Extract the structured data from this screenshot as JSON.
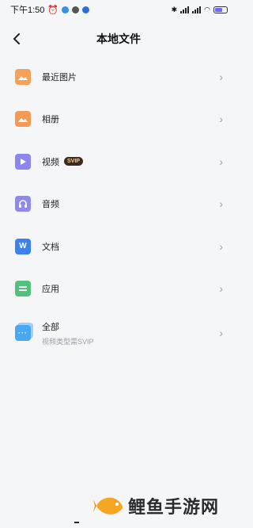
{
  "status_bar": {
    "time": "下午1:50",
    "battery_color": "#6b6bff"
  },
  "header": {
    "title": "本地文件",
    "back_icon": "chevron-left-icon"
  },
  "items": [
    {
      "label": "最近图片",
      "icon": "image-icon",
      "color": "#f5a15a"
    },
    {
      "label": "相册",
      "icon": "album-icon",
      "color": "#f59a55"
    },
    {
      "label": "视频",
      "icon": "video-play-icon",
      "color": "#8e86f0",
      "badge": "SVIP"
    },
    {
      "label": "音频",
      "icon": "headphones-icon",
      "color": "#8f89ef"
    },
    {
      "label": "文档",
      "icon": "word-doc-icon",
      "color": "#3b82f0",
      "glyph": "W"
    },
    {
      "label": "应用",
      "icon": "app-package-icon",
      "color": "#52c27a"
    },
    {
      "label": "全部",
      "icon": "all-files-icon",
      "color": "#4aa8f0",
      "sublabel": "视频类型需SVIP"
    }
  ],
  "watermark": {
    "text": "鲤鱼手游网"
  }
}
